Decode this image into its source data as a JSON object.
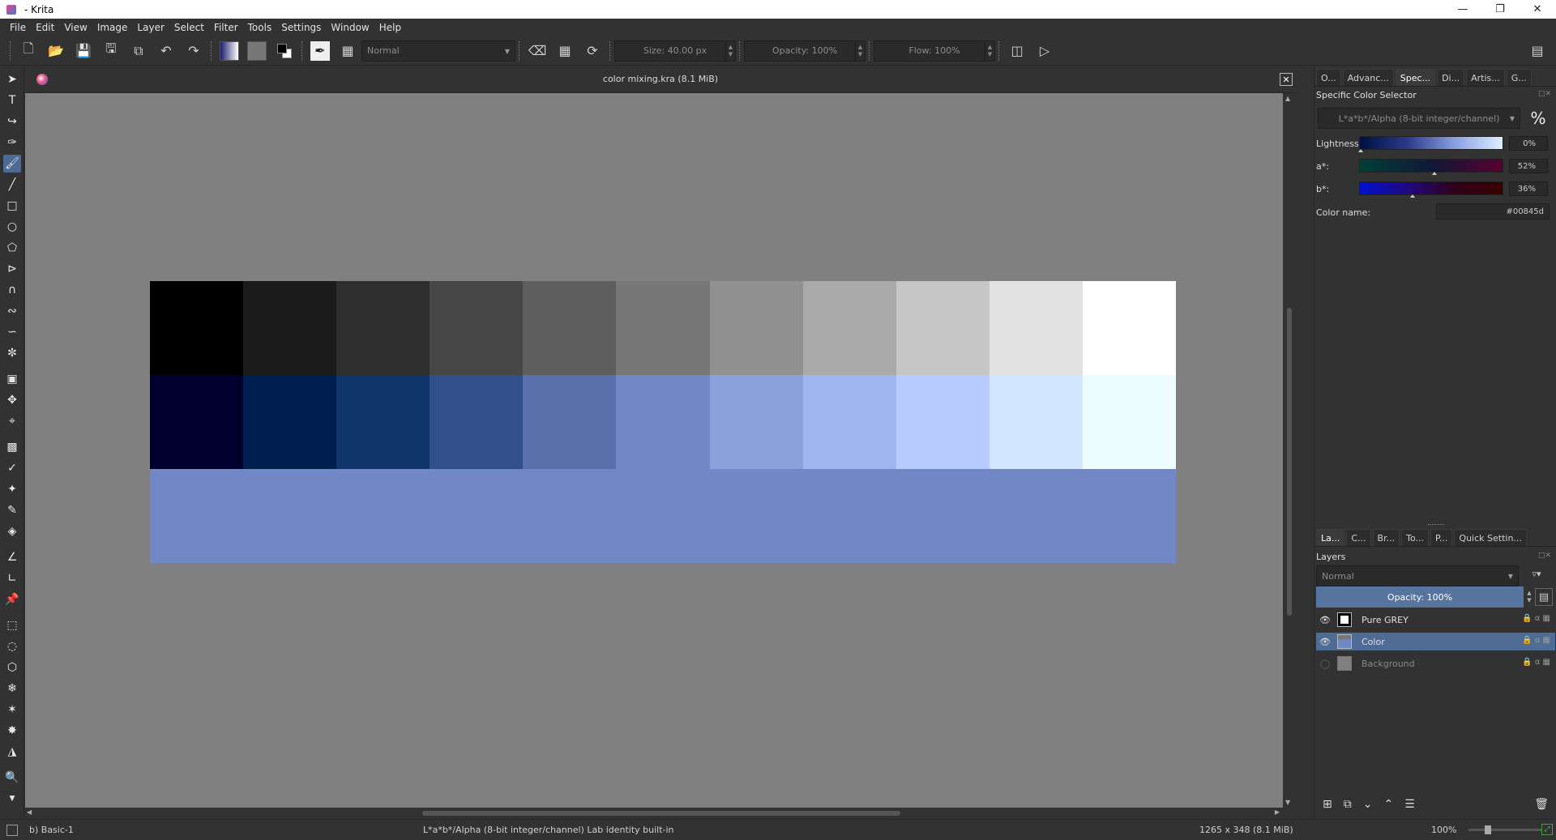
{
  "window": {
    "title": "- Krita"
  },
  "menu": [
    "File",
    "Edit",
    "View",
    "Image",
    "Layer",
    "Select",
    "Filter",
    "Tools",
    "Settings",
    "Window",
    "Help"
  ],
  "toolbar": {
    "blend_mode": "Normal",
    "size": "Size: 40.00 px",
    "opacity": "Opacity: 100%",
    "flow": "Flow: 100%"
  },
  "document": {
    "title": "color mixing.kra (8.1 MiB)"
  },
  "swatches": {
    "gray_row": [
      "#000000",
      "#1b1b1b",
      "#2e2e2e",
      "#474747",
      "#5e5e5e",
      "#777777",
      "#919191",
      "#aaaaaa",
      "#c6c6c6",
      "#e2e2e2",
      "#ffffff"
    ],
    "blue_row": [
      "#00002e",
      "#001f4f",
      "#11346d",
      "#314f8a",
      "#5a6fab",
      "#7288c6",
      "#8ba0dc",
      "#a0b4f2",
      "#b7cbff",
      "#d3e6ff",
      "#eefdff"
    ],
    "fill": "#7288c6"
  },
  "docker_top": {
    "tabs": [
      "O...",
      "Advanc...",
      "Spec...",
      "Di...",
      "Artis...",
      "G..."
    ],
    "panel_title": "Specific Color Selector",
    "color_space": "L*a*b*/Alpha (8-bit integer/channel)",
    "percent_toggle": "%",
    "lightness_label": "Lightness:",
    "lightness_value": "0%",
    "a_label": "a*:",
    "a_value": "52%",
    "b_label": "b*:",
    "b_value": "36%",
    "color_name_label": "Color name:",
    "color_name_value": "#00845d"
  },
  "docker_bottom": {
    "tabs": [
      "La...",
      "C...",
      "Br...",
      "To...",
      "P...",
      "Quick Settin..."
    ],
    "panel_title": "Layers",
    "blend_mode": "Normal",
    "opacity": "Opacity: 100%",
    "layers": [
      {
        "name": "Pure GREY",
        "visible": true,
        "selected": false
      },
      {
        "name": "Color",
        "visible": true,
        "selected": true
      },
      {
        "name": "Background",
        "visible": false,
        "selected": false
      }
    ]
  },
  "status": {
    "brush": "b) Basic-1",
    "color_space": "L*a*b*/Alpha (8-bit integer/channel)  Lab identity built-in",
    "image_size": "1265 x 348 (8.1 MiB)",
    "zoom": "100%"
  }
}
